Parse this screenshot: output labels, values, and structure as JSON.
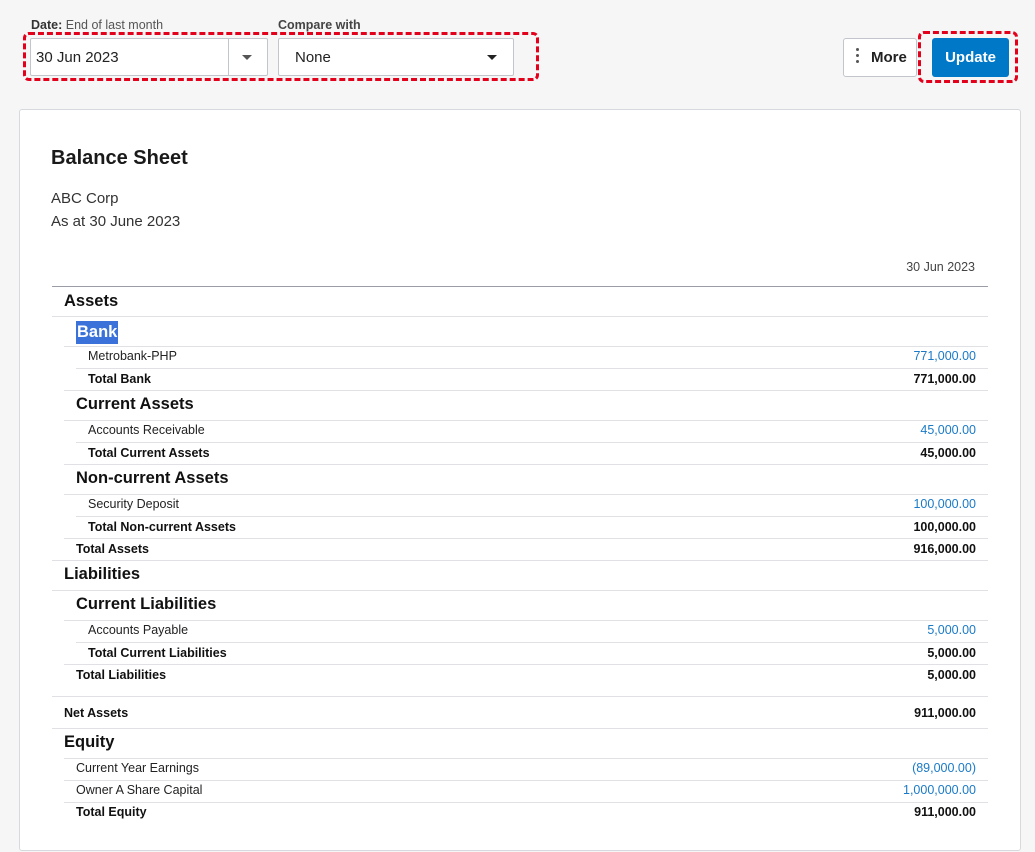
{
  "filters": {
    "date_label_prefix": "Date:",
    "date_label_suffix": "End of last month",
    "date_value": "30 Jun 2023",
    "compare_label": "Compare with",
    "compare_value": "None"
  },
  "toolbar": {
    "more_label": "More",
    "update_label": "Update"
  },
  "report": {
    "title": "Balance Sheet",
    "company": "ABC Corp",
    "as_at": "As at 30 June 2023",
    "column_header": "30 Jun 2023",
    "rows": [
      {
        "label": "Assets",
        "amount": ""
      },
      {
        "label": "Bank",
        "amount": ""
      },
      {
        "label": "Metrobank-PHP",
        "amount": "771,000.00"
      },
      {
        "label": "Total Bank",
        "amount": "771,000.00"
      },
      {
        "label": "Current Assets",
        "amount": ""
      },
      {
        "label": "Accounts Receivable",
        "amount": "45,000.00"
      },
      {
        "label": "Total Current Assets",
        "amount": "45,000.00"
      },
      {
        "label": "Non-current Assets",
        "amount": ""
      },
      {
        "label": "Security Deposit",
        "amount": "100,000.00"
      },
      {
        "label": "Total Non-current Assets",
        "amount": "100,000.00"
      },
      {
        "label": "Total Assets",
        "amount": "916,000.00"
      },
      {
        "label": "Liabilities",
        "amount": ""
      },
      {
        "label": "Current Liabilities",
        "amount": ""
      },
      {
        "label": "Accounts Payable",
        "amount": "5,000.00"
      },
      {
        "label": "Total Current Liabilities",
        "amount": "5,000.00"
      },
      {
        "label": "Total Liabilities",
        "amount": "5,000.00"
      },
      {
        "label": "Net Assets",
        "amount": "911,000.00"
      },
      {
        "label": "Equity",
        "amount": ""
      },
      {
        "label": "Current Year Earnings",
        "amount": "(89,000.00)"
      },
      {
        "label": "Owner A Share Capital",
        "amount": "1,000,000.00"
      },
      {
        "label": "Total Equity",
        "amount": "911,000.00"
      }
    ]
  },
  "colors": {
    "accent": "#0078c8",
    "link": "#1a7ac7",
    "highlight_dash": "#e3001b",
    "selection": "#3a72d9"
  }
}
